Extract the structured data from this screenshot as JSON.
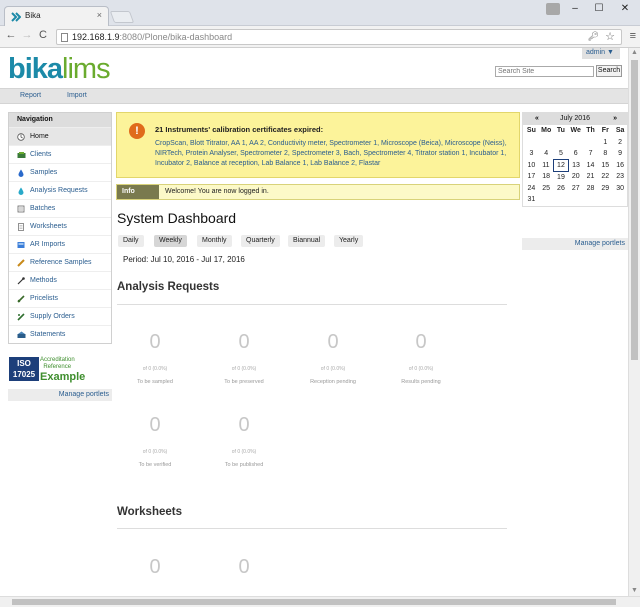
{
  "browser": {
    "tab_title": "Bika",
    "tab_close": "×",
    "url_host": "192.168.1.9",
    "url_path": ":8080/Plone/bika-dashboard",
    "back": "←",
    "forward": "→",
    "reload": "C",
    "minimize": "–",
    "maximize": "☐",
    "close": "✕"
  },
  "header": {
    "admin_label": "admin ▼",
    "logo_part1": "bika",
    "logo_part2": "lims",
    "search_placeholder": "Search Site",
    "search_button": "Search"
  },
  "topnav": [
    "Report",
    "Import"
  ],
  "navigation": {
    "title": "Navigation",
    "items": [
      {
        "label": "Home",
        "icon": "home-icon"
      },
      {
        "label": "Clients",
        "icon": "clients-icon"
      },
      {
        "label": "Samples",
        "icon": "sample-drop-icon"
      },
      {
        "label": "Analysis Requests",
        "icon": "analysis-request-icon"
      },
      {
        "label": "Batches",
        "icon": "batches-icon"
      },
      {
        "label": "Worksheets",
        "icon": "worksheet-icon"
      },
      {
        "label": "AR Imports",
        "icon": "ar-imports-icon"
      },
      {
        "label": "Reference Samples",
        "icon": "reference-samples-icon"
      },
      {
        "label": "Methods",
        "icon": "methods-icon"
      },
      {
        "label": "Pricelists",
        "icon": "pricelists-icon"
      },
      {
        "label": "Supply Orders",
        "icon": "supply-orders-icon"
      },
      {
        "label": "Statements",
        "icon": "statements-icon"
      }
    ],
    "manage_portlets": "Manage portlets"
  },
  "iso_badge": {
    "line1": "ISO",
    "line2": "17025",
    "text1": "Accreditation",
    "text2": "Reference",
    "text3": "Example"
  },
  "alert": {
    "heading": "21 Instruments' calibration certificates expired:",
    "instruments": "CropScan, Blott Titrator, AA 1, AA 2, Conductivity meter, Spectrometer 1, Microscope (Beica), Microscope (Neiss), NIRTech, Protein Analyser, Spectrometer 2, Spectrometer 3, Bach, Spectrometer 4, Titrator station 1, Incubator 1, Incubator 2, Balance at reception, Lab Balance 1, Lab Balance 2, Flastar"
  },
  "info": {
    "label": "Info",
    "message": "Welcome! You are now logged in."
  },
  "dashboard": {
    "title": "System Dashboard",
    "periods": [
      "Daily",
      "Weekly",
      "Monthly",
      "Quarterly",
      "Biannual",
      "Yearly"
    ],
    "selected_period": "Weekly",
    "period_text": "Period:  Jul 10, 2016 -  Jul 17, 2016"
  },
  "analysis_requests": {
    "title": "Analysis Requests",
    "stats": [
      {
        "value": "0",
        "of": "of 0 (0.0%)",
        "caption": "To be sampled"
      },
      {
        "value": "0",
        "of": "of 0 (0.0%)",
        "caption": "To be preserved"
      },
      {
        "value": "0",
        "of": "of 0 (0.0%)",
        "caption": "Reception pending"
      },
      {
        "value": "0",
        "of": "of 0 (0.0%)",
        "caption": "Results pending"
      },
      {
        "value": "0",
        "of": "of 0 (0.0%)",
        "caption": "To be verified"
      },
      {
        "value": "0",
        "of": "of 0 (0.0%)",
        "caption": "To be published"
      }
    ]
  },
  "worksheets": {
    "title": "Worksheets",
    "stats": [
      {
        "value": "0"
      },
      {
        "value": "0"
      }
    ]
  },
  "calendar": {
    "prev": "«",
    "next": "»",
    "month": "July 2016",
    "days": [
      "Su",
      "Mo",
      "Tu",
      "We",
      "Th",
      "Fr",
      "Sa"
    ],
    "weeks": [
      [
        "",
        "",
        "",
        "",
        "",
        "1",
        "2"
      ],
      [
        "3",
        "4",
        "5",
        "6",
        "7",
        "8",
        "9"
      ],
      [
        "10",
        "11",
        "12",
        "13",
        "14",
        "15",
        "16"
      ],
      [
        "17",
        "18",
        "19",
        "20",
        "21",
        "22",
        "23"
      ],
      [
        "24",
        "25",
        "26",
        "27",
        "28",
        "29",
        "30"
      ],
      [
        "31",
        "",
        "",
        "",
        "",
        "",
        ""
      ]
    ],
    "today": "12",
    "manage_portlets": "Manage portlets"
  }
}
